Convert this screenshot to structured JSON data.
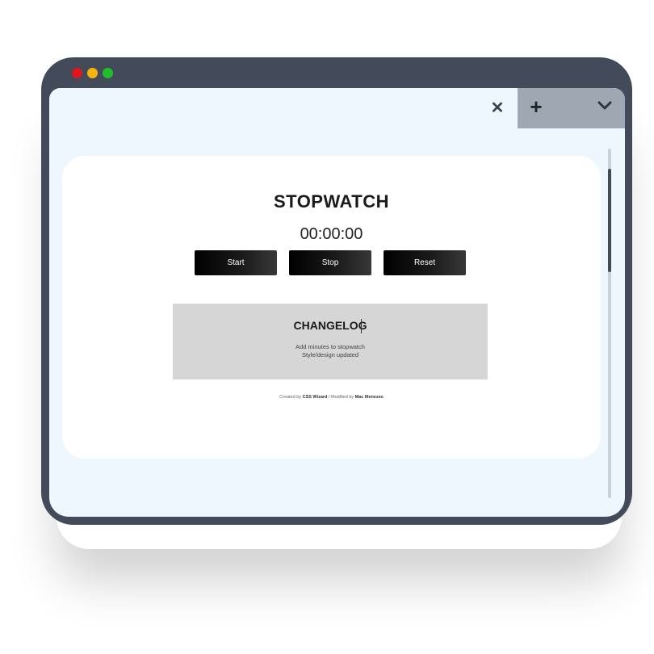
{
  "window": {
    "controls": [
      "red",
      "yellow",
      "green"
    ],
    "tab_icons": {
      "close": "close-icon",
      "new_tab": "plus-icon",
      "menu": "chevron-down-icon"
    },
    "close_glyph": "✕",
    "plus_glyph": "+"
  },
  "app": {
    "title": "STOPWATCH",
    "time": "00:00:00",
    "buttons": {
      "start": "Start",
      "stop": "Stop",
      "reset": "Reset"
    }
  },
  "changelog": {
    "title": "CHANGELOG",
    "entries": [
      "Add minutes to stopwatch",
      "Style/design updated"
    ]
  },
  "footer": {
    "created_prefix": "Created by",
    "creator": "CSS Wizard",
    "separator": "/ Modified by",
    "modifier": "Mac Menezes"
  },
  "colors": {
    "frame": "#434b5a",
    "screen": "#eef7fd",
    "tab_strip": "#9ea7b2",
    "card": "#ffffff",
    "changelog_bg": "#d6d6d6",
    "button": "#000000",
    "dot_red": "#e0161e",
    "dot_yellow": "#f5b50d",
    "dot_green": "#1fbf2c"
  }
}
